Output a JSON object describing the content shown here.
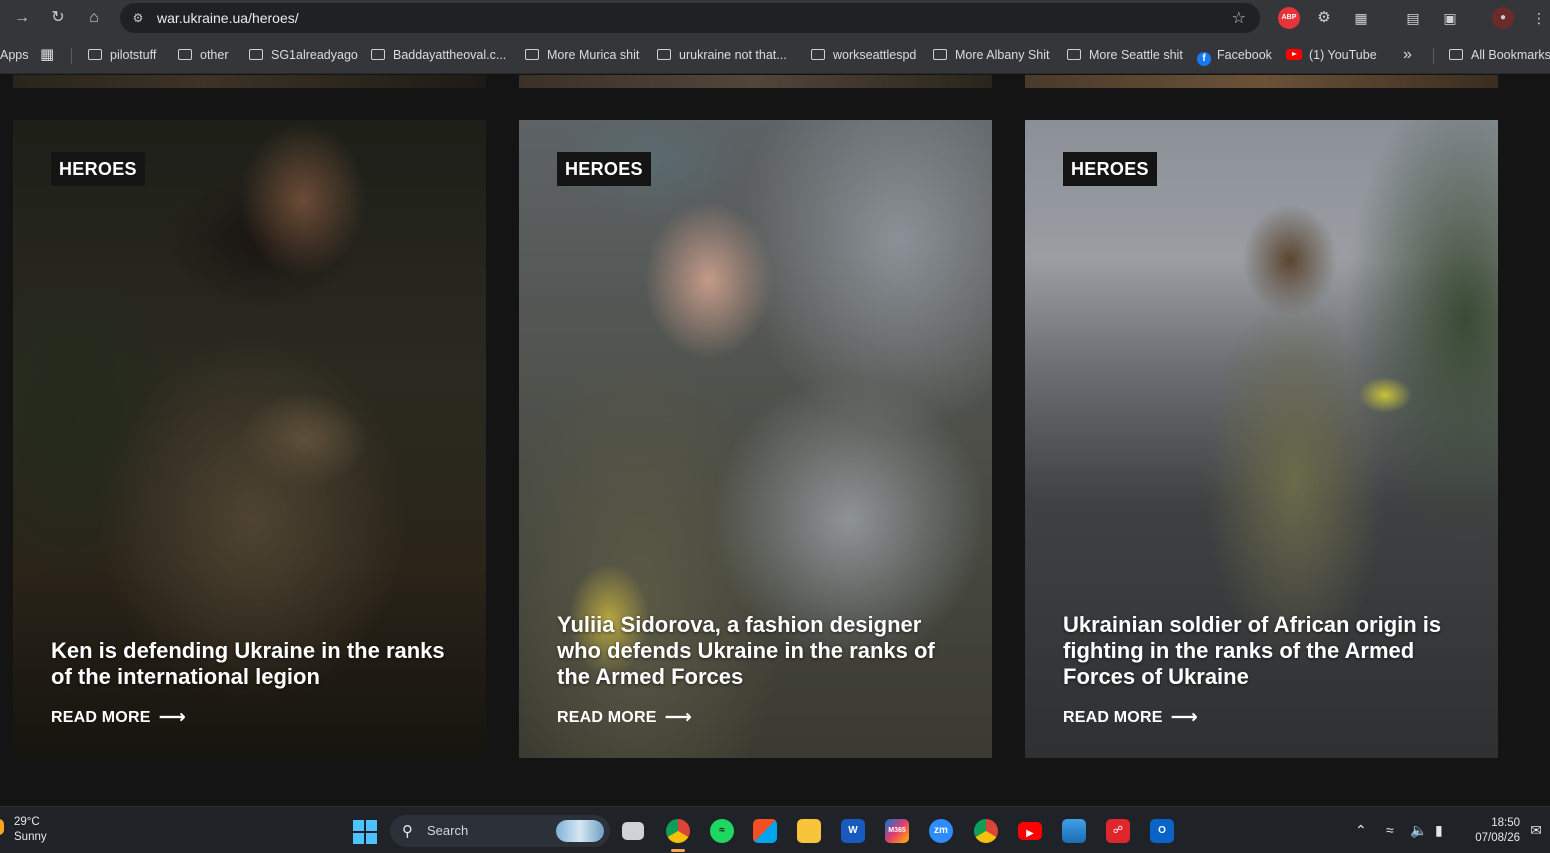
{
  "browser": {
    "url_host": "war.ukraine.ua",
    "url_path": "/heroes/",
    "bookmarks": [
      {
        "label": "Apps",
        "type": "apps"
      },
      {
        "label": "pilotstuff",
        "type": "folder"
      },
      {
        "label": "other",
        "type": "folder"
      },
      {
        "label": "SG1alreadyago",
        "type": "folder"
      },
      {
        "label": "Baddayattheoval.c...",
        "type": "folder"
      },
      {
        "label": "More Murica shit",
        "type": "folder"
      },
      {
        "label": "urukraine not that...",
        "type": "folder"
      },
      {
        "label": "workseattlespd",
        "type": "folder"
      },
      {
        "label": "More Albany Shit",
        "type": "folder"
      },
      {
        "label": "More Seattle shit",
        "type": "folder"
      },
      {
        "label": "Facebook",
        "type": "facebook"
      },
      {
        "label": "(1) YouTube",
        "type": "youtube"
      },
      {
        "label": "All Bookmarks",
        "type": "folder"
      }
    ],
    "overflow_label": "»",
    "extension_abp_label": "ABP"
  },
  "cards": [
    {
      "category": "HEROES",
      "title": "Ken is defending Ukraine in the ranks of the international legion",
      "cta": "READ MORE",
      "cta_arrow": "⟶"
    },
    {
      "category": "HEROES",
      "title": "Yuliia Sidorova, a fashion designer who defends Ukraine in the ranks of the Armed Forces",
      "cta": "READ MORE",
      "cta_arrow": "⟶"
    },
    {
      "category": "HEROES",
      "title": "Ukrainian soldier of African origin is fighting in the ranks of the Armed Forces of Ukraine",
      "cta": "READ MORE",
      "cta_arrow": "⟶"
    }
  ],
  "taskbar": {
    "weather_temp": "29°C",
    "weather_desc": "Sunny",
    "search_label": "Search",
    "time": "18:50",
    "date": "07/08/26",
    "apps": [
      "chrome",
      "spotify",
      "store",
      "file-explorer",
      "word",
      "m365",
      "zoom",
      "chrome",
      "youtube",
      "photos",
      "vpn",
      "outlook"
    ],
    "m365_label": "M365",
    "zoom_label": "zm"
  },
  "colors": {
    "page_bg": "#141414",
    "badge_bg": "#141414",
    "chrome_toolbar": "#35363a",
    "taskbar_bg": "#1f2227",
    "accent_orange": "#ffa44a"
  }
}
